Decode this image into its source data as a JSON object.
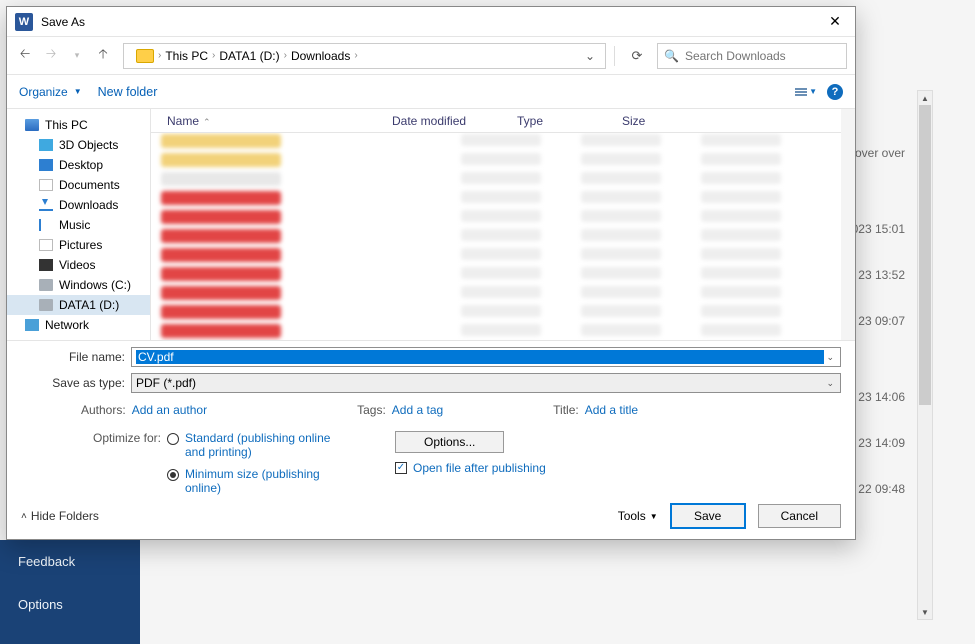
{
  "dialog": {
    "title": "Save As",
    "nav": {
      "back_tip": "Back",
      "fwd_tip": "Forward",
      "up_tip": "Up"
    },
    "breadcrumb": [
      "This PC",
      "DATA1 (D:)",
      "Downloads"
    ],
    "search_placeholder": "Search Downloads",
    "toolbar": {
      "organize": "Organize",
      "new_folder": "New folder"
    },
    "tree": [
      {
        "label": "This PC",
        "icon": "pc",
        "lvl": 1
      },
      {
        "label": "3D Objects",
        "icon": "3d",
        "lvl": 2
      },
      {
        "label": "Desktop",
        "icon": "desktop",
        "lvl": 2
      },
      {
        "label": "Documents",
        "icon": "doc",
        "lvl": 2
      },
      {
        "label": "Downloads",
        "icon": "dl",
        "lvl": 2
      },
      {
        "label": "Music",
        "icon": "music",
        "lvl": 2
      },
      {
        "label": "Pictures",
        "icon": "pic",
        "lvl": 2
      },
      {
        "label": "Videos",
        "icon": "vid",
        "lvl": 2
      },
      {
        "label": "Windows (C:)",
        "icon": "drive",
        "lvl": 2
      },
      {
        "label": "DATA1 (D:)",
        "icon": "drive",
        "lvl": 2,
        "selected": true
      },
      {
        "label": "Network",
        "icon": "net",
        "lvl": 1
      }
    ],
    "list_headers": {
      "name": "Name",
      "date": "Date modified",
      "type": "Type",
      "size": "Size"
    },
    "file_name_label": "File name:",
    "file_name_value": "CV.pdf",
    "save_type_label": "Save as type:",
    "save_type_value": "PDF (*.pdf)",
    "meta": {
      "authors_label": "Authors:",
      "authors_value": "Add an author",
      "tags_label": "Tags:",
      "tags_value": "Add a tag",
      "title_label": "Title:",
      "title_value": "Add a title"
    },
    "optimize_label": "Optimize for:",
    "optimize": {
      "standard": "Standard (publishing online and printing)",
      "minimum": "Minimum size (publishing online)"
    },
    "options_btn": "Options...",
    "open_after_label": "Open file after publishing",
    "hide_folders": "Hide Folders",
    "tools": "Tools",
    "save": "Save",
    "cancel": "Cancel"
  },
  "background": {
    "feedback": "Feedback",
    "options": "Options",
    "hover_text": "u hover over",
    "timestamps": [
      "023 15:01",
      "23 13:52",
      "23 09:07",
      "23 14:06",
      "23 14:09",
      "22 09:48"
    ]
  }
}
